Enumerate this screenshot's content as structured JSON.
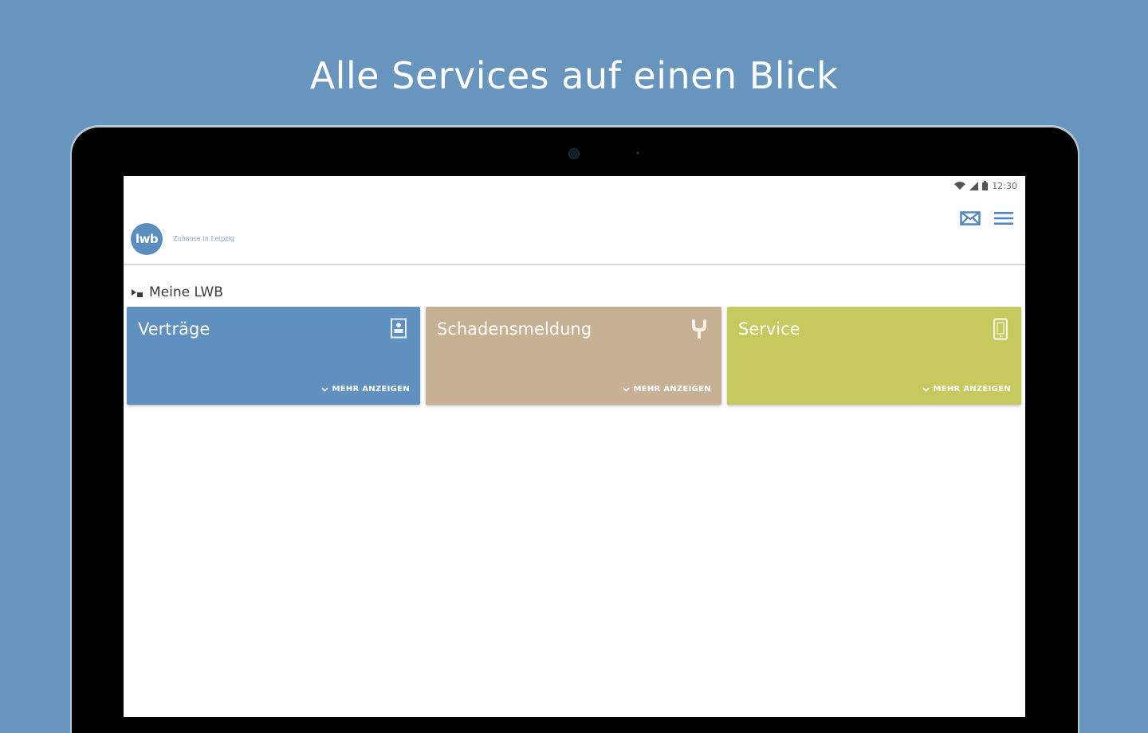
{
  "headline": "Alle Services auf einen Blick",
  "status_bar": {
    "time": "12:30",
    "icons": [
      "wifi-icon",
      "signal-icon",
      "battery-icon"
    ]
  },
  "app": {
    "logo_text": "lwb",
    "tagline": "Zuhause in Leipzig",
    "actions": [
      "mail-icon",
      "menu-icon"
    ]
  },
  "section": {
    "title": "Meine LWB",
    "icon": "home-icon"
  },
  "tiles": [
    {
      "title": "Verträge",
      "icon": "contract-icon",
      "more_label": "MEHR ANZEIGEN",
      "color": "#5f90bf"
    },
    {
      "title": "Schadensmeldung",
      "icon": "plumbing-icon",
      "more_label": "MEHR ANZEIGEN",
      "color": "#c6b194"
    },
    {
      "title": "Service",
      "icon": "mobile-icon",
      "more_label": "MEHR ANZEIGEN",
      "color": "#c5c95e"
    }
  ],
  "colors": {
    "background": "#6895bd",
    "logo": "#5b8dbd",
    "accent": "#4f86bf"
  }
}
